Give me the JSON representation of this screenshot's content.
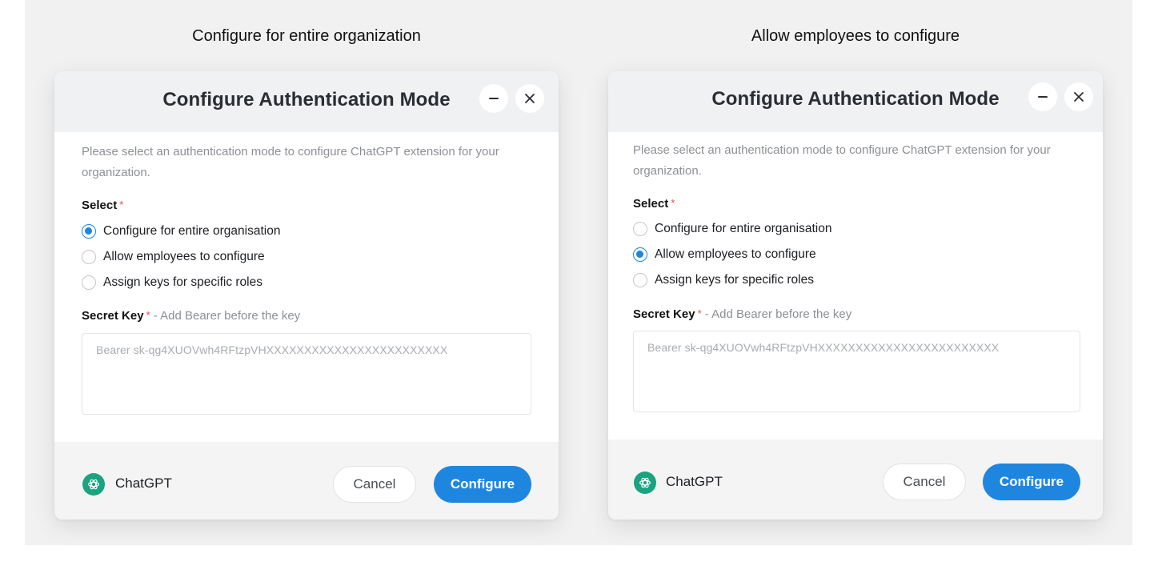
{
  "panels": [
    {
      "caption": "Configure for entire organization",
      "dialog": {
        "title": "Configure Authentication Mode",
        "description": "Please select an authentication mode to configure ChatGPT extension for your organization.",
        "select_label": "Select",
        "required_mark": "*",
        "options": [
          {
            "label": "Configure for entire organisation",
            "selected": true
          },
          {
            "label": "Allow employees to configure",
            "selected": false
          },
          {
            "label": "Assign keys for specific roles",
            "selected": false
          }
        ],
        "secret_key_label": "Secret Key",
        "secret_key_hint": " - Add Bearer before the key",
        "secret_key_value": "Bearer sk-qg4XUOVwh4RFtzpVHXXXXXXXXXXXXXXXXXXXXXXXX",
        "app_name": "ChatGPT",
        "cancel_label": "Cancel",
        "configure_label": "Configure"
      }
    },
    {
      "caption": "Allow employees to configure",
      "dialog": {
        "title": "Configure Authentication Mode",
        "description": "Please select an authentication mode to configure ChatGPT extension for your organization.",
        "select_label": "Select",
        "required_mark": "*",
        "options": [
          {
            "label": "Configure for entire organisation",
            "selected": false
          },
          {
            "label": "Allow employees to configure",
            "selected": true
          },
          {
            "label": "Assign keys for specific roles",
            "selected": false
          }
        ],
        "secret_key_label": "Secret Key",
        "secret_key_hint": " - Add Bearer before the key",
        "secret_key_value": "Bearer sk-qg4XUOVwh4RFtzpVHXXXXXXXXXXXXXXXXXXXXXXXX",
        "app_name": "ChatGPT",
        "cancel_label": "Cancel",
        "configure_label": "Configure"
      }
    }
  ],
  "icons": {
    "minimize": "minus-icon",
    "close": "close-icon",
    "app_logo": "chatgpt-logo-icon"
  },
  "colors": {
    "accent": "#1f86e0",
    "required": "#e5484d",
    "app_logo": "#19a37f"
  }
}
